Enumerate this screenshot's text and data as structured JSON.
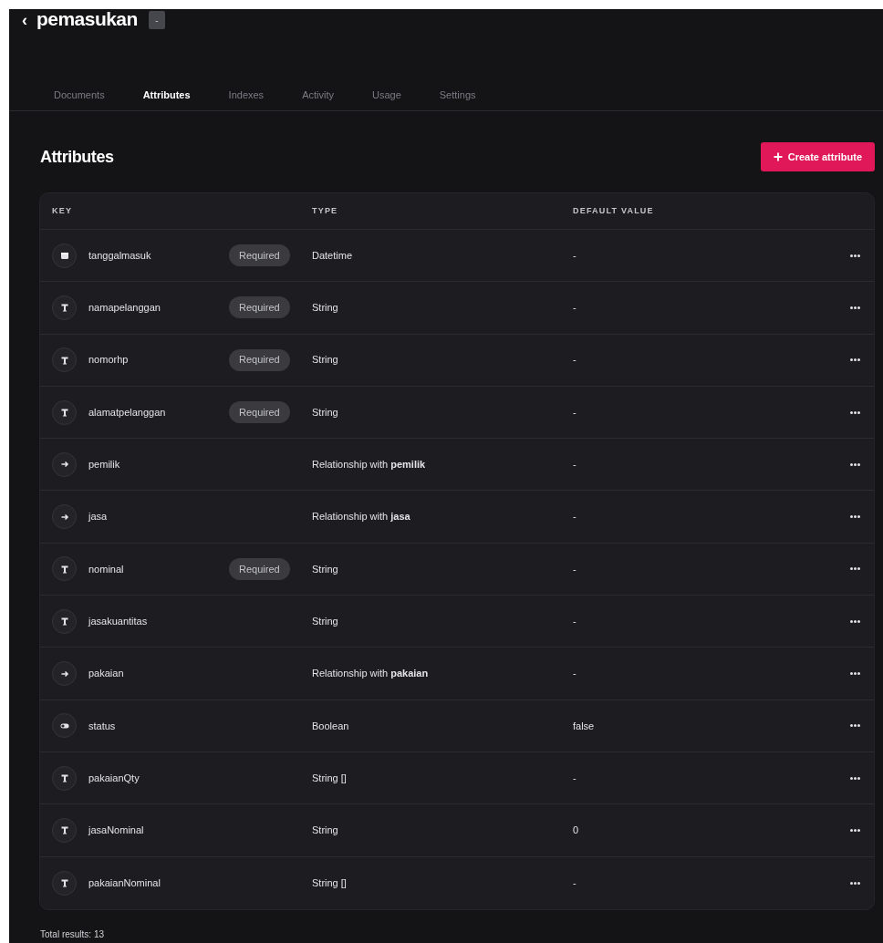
{
  "header": {
    "back": "‹",
    "title": "pemasukan",
    "badge": "-"
  },
  "tabs": [
    {
      "label": "Documents",
      "selected": false
    },
    {
      "label": "Attributes",
      "selected": true
    },
    {
      "label": "Indexes",
      "selected": false
    },
    {
      "label": "Activity",
      "selected": false
    },
    {
      "label": "Usage",
      "selected": false
    },
    {
      "label": "Settings",
      "selected": false
    }
  ],
  "section": {
    "title": "Attributes",
    "create_button": "Create attribute"
  },
  "table": {
    "columns": [
      "KEY",
      "TYPE",
      "DEFAULT VALUE"
    ],
    "rows": [
      {
        "kind": "datetime",
        "key": "tanggalmasuk",
        "tag": "Required",
        "type": "Datetime",
        "default": "-"
      },
      {
        "kind": "string",
        "key": "namapelanggan",
        "tag": "Required",
        "type": "String",
        "default": "-"
      },
      {
        "kind": "string",
        "key": "nomorhp",
        "tag": "Required",
        "type": "String",
        "default": "-"
      },
      {
        "kind": "string",
        "key": "alamatpelanggan",
        "tag": "Required",
        "type": "String",
        "default": "-"
      },
      {
        "kind": "relationship",
        "key": "pemilik",
        "type": "Relationship with **pemilik**",
        "default": "-"
      },
      {
        "kind": "relationship",
        "key": "jasa",
        "type": "Relationship with **jasa**",
        "default": "-"
      },
      {
        "kind": "string",
        "key": "nominal",
        "tag": "Required",
        "type": "String",
        "default": "-"
      },
      {
        "kind": "string",
        "key": "jasakuantitas",
        "type": "String",
        "default": "-"
      },
      {
        "kind": "relationship",
        "key": "pakaian",
        "type": "Relationship with **pakaian**",
        "default": "-"
      },
      {
        "kind": "boolean",
        "key": "status",
        "type": "Boolean",
        "default": "false"
      },
      {
        "kind": "string",
        "key": "pakaianQty",
        "type": "String []",
        "default": "-"
      },
      {
        "kind": "string",
        "key": "jasaNominal",
        "type": "String",
        "default": "0"
      },
      {
        "kind": "string",
        "key": "pakaianNominal",
        "type": "String []",
        "default": "-"
      }
    ]
  },
  "footer": {
    "total": "Total results: 13"
  }
}
